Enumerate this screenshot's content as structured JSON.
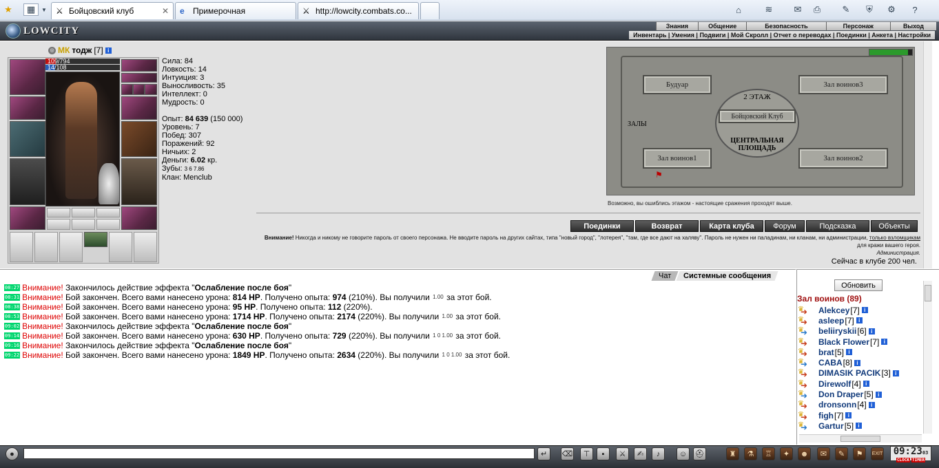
{
  "browser": {
    "tabs": [
      {
        "label": "Бойцовский клуб",
        "active": true
      },
      {
        "label": "Примерочная",
        "active": false
      },
      {
        "label": "http://lowcity.combats.co...",
        "active": false
      }
    ]
  },
  "header": {
    "logo": "LOWCITY",
    "menu_top": [
      "Знания",
      "Общение",
      "Безопасность",
      "Персонаж",
      "Выход"
    ],
    "menu_sub": "Инвентарь | Умения | Подвиги | Мой Скролл | Отчет о переводах | Поединки | Анкета | Настройки"
  },
  "character": {
    "clan_prefix": "МК",
    "name": "тодж",
    "level": "[7]",
    "hp": "109/794",
    "mana": "14/108",
    "stats": {
      "strength": "Сила: 84",
      "agility": "Ловкость: 14",
      "intuition": "Интуиция: 3",
      "endurance": "Выносливость: 35",
      "intellect": "Интеллект: 0",
      "wisdom": "Мудрость: 0"
    },
    "exp_label": "Опыт: ",
    "exp_value": "84 639",
    "exp_next": " (150 000)",
    "level_line": "Уровень: 7",
    "wins": "Побед: 307",
    "losses": "Поражений: 92",
    "draws": "Ничьих: 2",
    "money_label": "Деньги: ",
    "money_value": "6.02",
    "money_unit": " кр.",
    "teeth_label": "Зубы: ",
    "teeth_values": "3  6  7.86",
    "clan": "Клан: Menclub"
  },
  "map": {
    "rooms": {
      "boudoir": "Будуар",
      "hall3": "Зал воинов3",
      "floor2": "2 ЭТАЖ",
      "club": "Бойцовский Клуб",
      "halls": "ЗАЛЫ",
      "square": "ЦЕНТРАЛЬНАЯ ПЛОЩАДЬ",
      "hall1": "Зал воинов1",
      "hall2": "Зал воинов2"
    },
    "note": "Возможно, вы ошиблись этажом - настоящие сражения проходят выше."
  },
  "actions": [
    "Поединки",
    "Возврат",
    "Карта клуба",
    "Форум",
    "Подсказка",
    "Объекты"
  ],
  "warning": {
    "bold": "Внимание!",
    "text": " Никогда и никому не говорите пароль от своего персонажа. Не вводите пароль на других сайтах, типа \"новый город\", \"лотерея\", \"там, где все дают на халяву\". Пароль не нужен ни паладинам, ни кланам, ни администрации, ",
    "underlined": "только взломщикам",
    "text2": " для кражи вашего героя.",
    "signature": "Администрация."
  },
  "online": "Сейчас в клубе 200 чел.",
  "chat": {
    "tabs": [
      "Чат",
      "Системные сообщения"
    ],
    "messages": [
      {
        "time": "08:27",
        "att": "Внимание!",
        "a": " Закончилось действие эффекта \"",
        "b": "Ослабление после боя",
        "c": "\"",
        "coins": ""
      },
      {
        "time": "08:31",
        "att": "Внимание!",
        "a": " Бой закончен. Всего вами нанесено урона: ",
        "b": "814 HP",
        "c": ". Получено опыта: ",
        "d": "974",
        "e": " (210%). Вы получили ",
        "coins": "1.00",
        "f": " за этот бой."
      },
      {
        "time": "08:38",
        "att": "Внимание!",
        "a": " Бой закончен. Всего вами нанесено урона: ",
        "b": "95 HP",
        "c": ". Получено опыта: ",
        "d": "112",
        "e": " (220%).",
        "coins": "",
        "f": ""
      },
      {
        "time": "08:53",
        "att": "Внимание!",
        "a": " Бой закончен. Всего вами нанесено урона: ",
        "b": "1714 HP",
        "c": ". Получено опыта: ",
        "d": "2174",
        "e": " (220%). Вы получили ",
        "coins": "1.00",
        "f": " за этот бой."
      },
      {
        "time": "09:02",
        "att": "Внимание!",
        "a": " Закончилось действие эффекта \"",
        "b": "Ослабление после боя",
        "c": "\"",
        "coins": ""
      },
      {
        "time": "09:14",
        "att": "Внимание!",
        "a": " Бой закончен. Всего вами нанесено урона: ",
        "b": "630 HP",
        "c": ". Получено опыта: ",
        "d": "729",
        "e": " (220%). Вы получили ",
        "coins": "1  0  1.00",
        "f": " за этот бой."
      },
      {
        "time": "09:16",
        "att": "Внимание!",
        "a": " Закончилось действие эффекта \"",
        "b": "Ослабление после боя",
        "c": "\"",
        "coins": ""
      },
      {
        "time": "09:22",
        "att": "Внимание!",
        "a": " Бой закончен. Всего вами нанесено урона: ",
        "b": "1849 HP",
        "c": ". Получено опыта: ",
        "d": "2634",
        "e": " (220%). Вы получили ",
        "coins": "1  0  1.00",
        "f": " за этот бой."
      }
    ]
  },
  "players": {
    "refresh": "Обновить",
    "room": "Зал воинов (89)",
    "list": [
      {
        "name": "Alekcey",
        "level": "[7]"
      },
      {
        "name": "asleep",
        "level": "[7]"
      },
      {
        "name": "beliiryskii",
        "level": "[6]"
      },
      {
        "name": "Black Flower",
        "level": "[7]"
      },
      {
        "name": "brat",
        "level": "[5]"
      },
      {
        "name": "CABA",
        "level": "[8]"
      },
      {
        "name": "DIMASIK PACIK",
        "level": "[3]"
      },
      {
        "name": "Direwolf",
        "level": "[4]"
      },
      {
        "name": "Don Draper",
        "level": "[5]"
      },
      {
        "name": "dronsonn",
        "level": "[4]"
      },
      {
        "name": "figh",
        "level": "[7]"
      },
      {
        "name": "Gartur",
        "level": "[5]"
      }
    ]
  },
  "clock": {
    "time": "09:23",
    "sec": "03",
    "clock_label": "CLOCK",
    "timer_label": "TIMER",
    "exit": "EXIT"
  },
  "colors": {
    "attention": "#dd0000",
    "timestamp": "#00d66e",
    "room_title": "#a01010",
    "player_name": "#10397a"
  }
}
